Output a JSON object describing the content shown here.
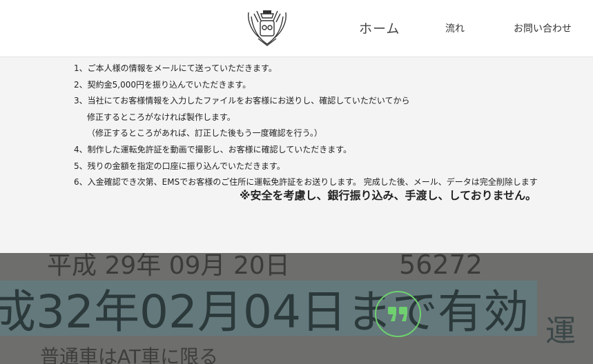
{
  "nav": {
    "items": [
      {
        "label": "ホーム"
      },
      {
        "label": "流れ"
      },
      {
        "label": "お問い合わせ"
      }
    ]
  },
  "steps": [
    "1、ご本人様の情報をメールにて送っていただきます。",
    "2、契約金5,000円を振り込んでいただきます。",
    "3、当社にてお客様情報を入力したファイルをお客様にお送りし、確認していただいてから",
    "修正するところがなければ製作します。",
    "（修正するところがあれば、訂正した後もう一度確認を行う。）",
    "4、制作した運転免許証を動画で撮影し、お客様に確認していただきます。",
    "5、残りの金額を指定の口座に振り込んでいただきます。",
    "6、入金確認でき次第、EMSでお客様のご住所に運転免許証をお送りします。 完成した後、メール、データは完全削除します"
  ],
  "notice": "※安全を考慮し、銀行振り込み、手渡し、しておりません。",
  "banner": {
    "line1": "平成 29年 09月 20日",
    "line1_number": "56272",
    "line2": "成32年02月04日まで有効",
    "line2_side": "運",
    "line3": "普通車はAT車に限る"
  },
  "colors": {
    "accent": "#6fd06f",
    "header_bg": "#ffffff",
    "content_bg": "#f4f4f4",
    "banner_bg": "#6e6e6c",
    "highlight": "#9ecad2"
  },
  "icons": {
    "logo": "crest-logo-icon",
    "quote": "quote-icon"
  }
}
